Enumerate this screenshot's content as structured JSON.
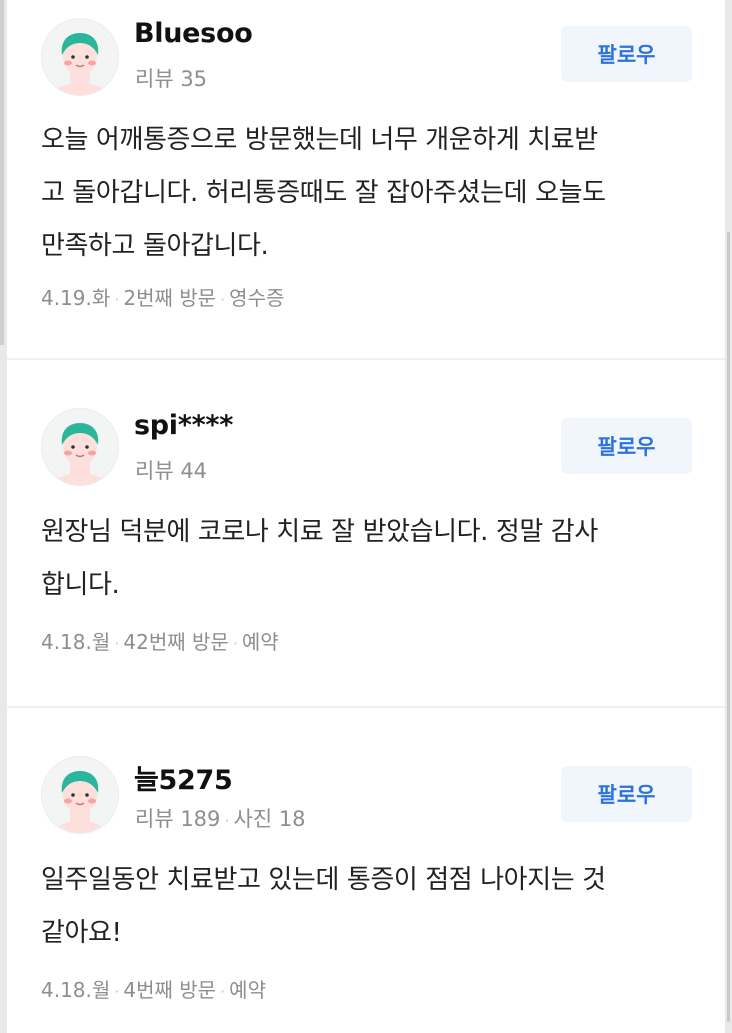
{
  "reviews": [
    {
      "user": "Bluesoo",
      "meta": [
        "리뷰 35"
      ],
      "follow_label": "팔로우",
      "text_lines": [
        "오늘 어깨통증으로 방문했는데 너무 개운하게 치료받",
        "고 돌아갑니다. 허리통증때도 잘 잡아주셨는데 오늘도",
        "만족하고 돌아갑니다."
      ],
      "footer": [
        "4.19.화",
        "2번째 방문",
        "영수증"
      ]
    },
    {
      "user": "spi****",
      "meta": [
        "리뷰 44"
      ],
      "follow_label": "팔로우",
      "text_lines": [
        "원장님 덕분에 코로나 치료 잘 받았습니다. 정말 감사",
        "합니다."
      ],
      "footer": [
        "4.18.월",
        "42번째 방문",
        "예약"
      ]
    },
    {
      "user": "늘5275",
      "meta": [
        "리뷰 189",
        "사진 18"
      ],
      "follow_label": "팔로우",
      "text_lines": [
        "일주일동안 치료받고 있는데 통증이 점점 나아지는 것",
        "같아요!"
      ],
      "footer": [
        "4.18.월",
        "4번째 방문",
        "예약"
      ]
    }
  ],
  "colors": {
    "accent": "#2e73dd",
    "follow_bg": "#f1f6fd",
    "muted_text": "#8e8e8e",
    "avatar_hair": "#2ab59d",
    "avatar_skin": "#fde0dc"
  },
  "icons": {
    "avatar": "default-profile-avatar-icon"
  }
}
